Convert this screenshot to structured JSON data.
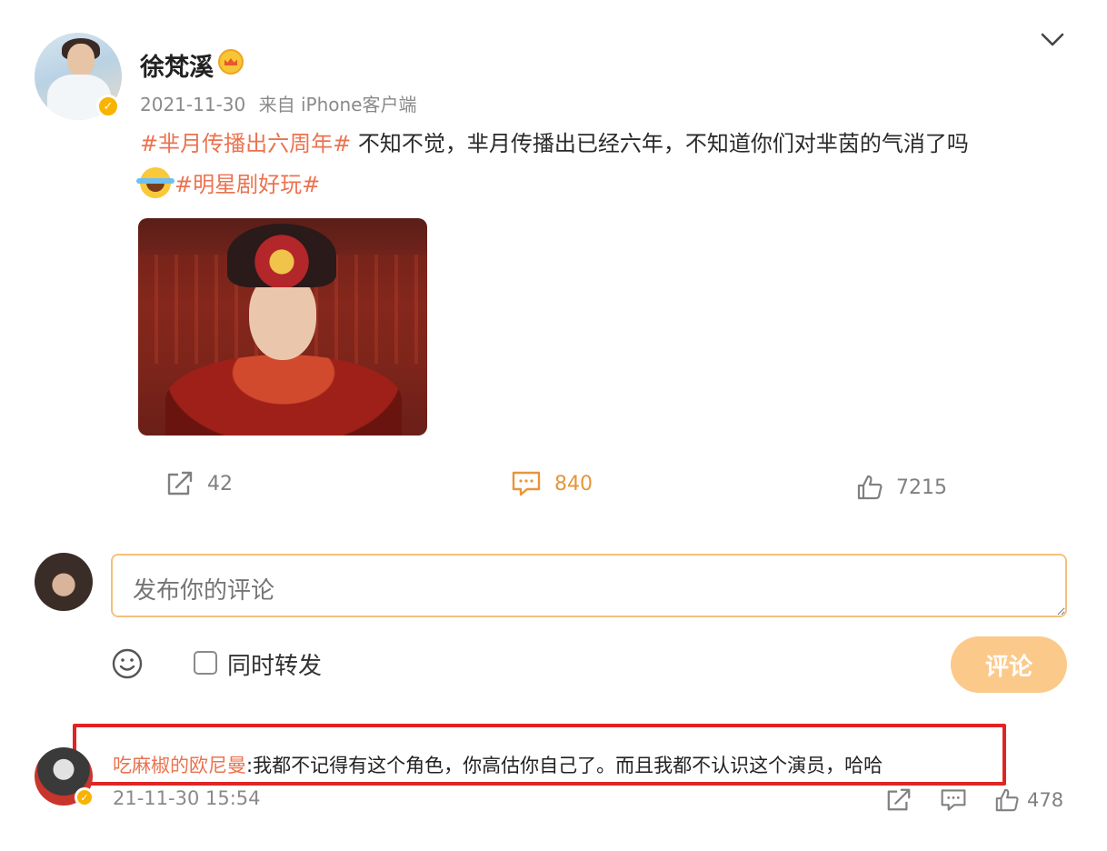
{
  "post": {
    "author": "徐梵溪",
    "timestamp": "2021-11-30",
    "source": "来自 iPhone客户端",
    "topic1": "#芈月传播出六周年#",
    "text1": " 不知不觉，芈月传播出已经六年，不知道你们对芈茵的气消了吗",
    "topic2": "#明星剧好玩#",
    "reposts": "42",
    "comments": "840",
    "likes": "7215"
  },
  "composer": {
    "placeholder": "发布你的评论",
    "repost_label": "同时转发",
    "submit_label": "评论"
  },
  "comment": {
    "author": "吃麻椒的欧尼曼",
    "text": ":我都不记得有这个角色，你高估你自己了。而且我都不认识这个演员，哈哈",
    "time": "21-11-30 15:54",
    "likes": "478"
  },
  "icons": {
    "expand": "chevron-down-icon",
    "verified": "verified-badge-icon",
    "member": "crown-icon",
    "repost": "share-icon",
    "comment": "comment-icon",
    "like": "thumbs-up-icon",
    "emoji": "smile-icon"
  },
  "colors": {
    "topic": "#eb7350",
    "accent": "#e8953a",
    "highlight": "#e02424",
    "submit": "#fbc98a"
  }
}
